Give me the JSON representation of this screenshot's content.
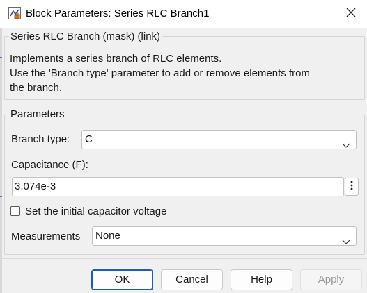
{
  "window": {
    "title": "Block Parameters: Series RLC Branch1"
  },
  "description_group": {
    "legend": "Series RLC Branch (mask) (link)",
    "lines": [
      "Implements a series branch of RLC elements.",
      "Use the 'Branch type' parameter to add or remove elements from",
      "the branch."
    ]
  },
  "parameters": {
    "legend": "Parameters",
    "branch_type": {
      "label": "Branch type:",
      "value": "C"
    },
    "capacitance": {
      "label": "Capacitance (F):",
      "value": "3.074e-3"
    },
    "initial_voltage_checkbox": {
      "label": "Set the initial capacitor voltage",
      "checked": false
    },
    "measurements": {
      "label": "Measurements",
      "value": "None"
    }
  },
  "buttons": {
    "ok": "OK",
    "cancel": "Cancel",
    "help": "Help",
    "apply": "Apply"
  },
  "icons": {
    "app": "simulink-block-icon",
    "close": "close-icon",
    "dropdown": "chevron-down-icon",
    "more": "more-options-icon"
  },
  "colors": {
    "primary_border": "#1c5fb0",
    "window_bg": "#f0f0f0"
  }
}
